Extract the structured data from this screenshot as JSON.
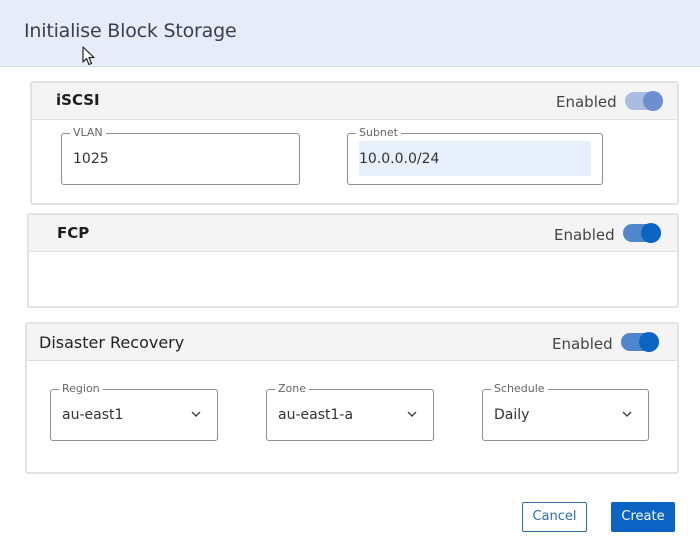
{
  "dialog": {
    "title": "Initialise Block Storage"
  },
  "iscsi": {
    "title": "iSCSI",
    "enabled_label": "Enabled",
    "toggle_on": true,
    "vlan": {
      "label": "VLAN",
      "value": "1025"
    },
    "subnet": {
      "label": "Subnet",
      "value": "10.0.0.0/24"
    }
  },
  "fcp": {
    "title": "FCP",
    "enabled_label": "Enabled",
    "toggle_on": true
  },
  "disaster_recovery": {
    "title": "Disaster Recovery",
    "enabled_label": "Enabled",
    "toggle_on": true,
    "region": {
      "label": "Region",
      "value": "au-east1"
    },
    "zone": {
      "label": "Zone",
      "value": "au-east1-a"
    },
    "schedule": {
      "label": "Schedule",
      "value": "Daily"
    }
  },
  "footer": {
    "cancel_label": "Cancel",
    "create_label": "Create"
  },
  "colors": {
    "header_bg": "#e6ecf9",
    "primary": "#0b63c4",
    "toggle_faded": "#6d8fd0"
  }
}
